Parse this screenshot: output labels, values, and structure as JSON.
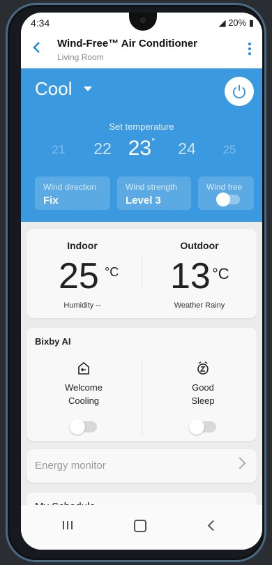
{
  "status_bar": {
    "time": "4:34",
    "indicators": " HD LTE .​ıl 20%",
    "battery": "20%"
  },
  "header": {
    "title": "Wind-Free™ Air Conditioner",
    "subtitle": "Living Room",
    "back_icon": "back-arrow-icon",
    "menu_icon": "more-vert-icon"
  },
  "control": {
    "mode": "Cool",
    "set_temperature_label": "Set temperature",
    "temps": [
      "21",
      "22",
      "23",
      "24",
      "25"
    ],
    "selected_temp": "23",
    "degree_mark": "°",
    "wind_direction": {
      "label": "Wind direction",
      "value": "Fix"
    },
    "wind_strength": {
      "label": "Wind strength",
      "value": "Level 3"
    },
    "wind_free": {
      "label": "Wind free",
      "enabled": false
    },
    "accent_color": "#3b99df"
  },
  "climate": {
    "indoor": {
      "label": "Indoor",
      "value": "25",
      "unit": "°C",
      "sub": "Humidity --"
    },
    "outdoor": {
      "label": "Outdoor",
      "value": "13",
      "unit": "°C",
      "sub": "Weather Rainy"
    }
  },
  "bixby": {
    "title": "Bixby AI",
    "items": [
      {
        "line1": "Welcome",
        "line2": "Cooling",
        "icon": "welcome-cooling-icon",
        "enabled": false
      },
      {
        "line1": "Good",
        "line2": "Sleep",
        "icon": "good-sleep-icon",
        "enabled": false
      }
    ]
  },
  "energy": {
    "label": "Energy monitor"
  },
  "next_card": {
    "label": "My Schedule"
  }
}
